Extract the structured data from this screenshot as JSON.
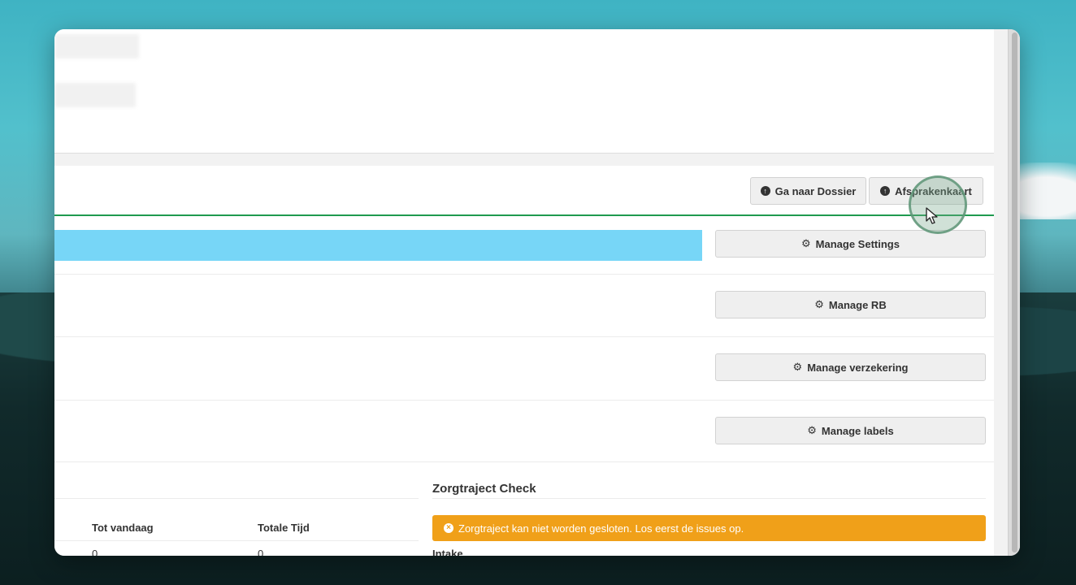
{
  "toolbar": {
    "dossier_label": "Ga naar Dossier",
    "afspraken_label": "Afsprakenkaart"
  },
  "manage": {
    "settings_label": "Manage Settings",
    "rb_label": "Manage RB",
    "verzekering_label": "Manage verzekering",
    "labels_label": "Manage labels"
  },
  "table": {
    "headers": [
      "Tot vandaag",
      "Totale Tijd"
    ],
    "row": [
      "0",
      "0"
    ]
  },
  "zorgtraject": {
    "title": "Zorgtraject Check",
    "alert": "Zorgtraject kan niet worden gesloten. Los eerst de issues op.",
    "intake_label": "Intake"
  },
  "colors": {
    "accent_green": "#1f9a4f",
    "progress_blue": "#77d6f7",
    "alert_orange": "#f0a019"
  },
  "icons": {
    "up": "arrow-circle-up-icon",
    "gear": "gear-icon",
    "warning": "times-circle-icon"
  }
}
